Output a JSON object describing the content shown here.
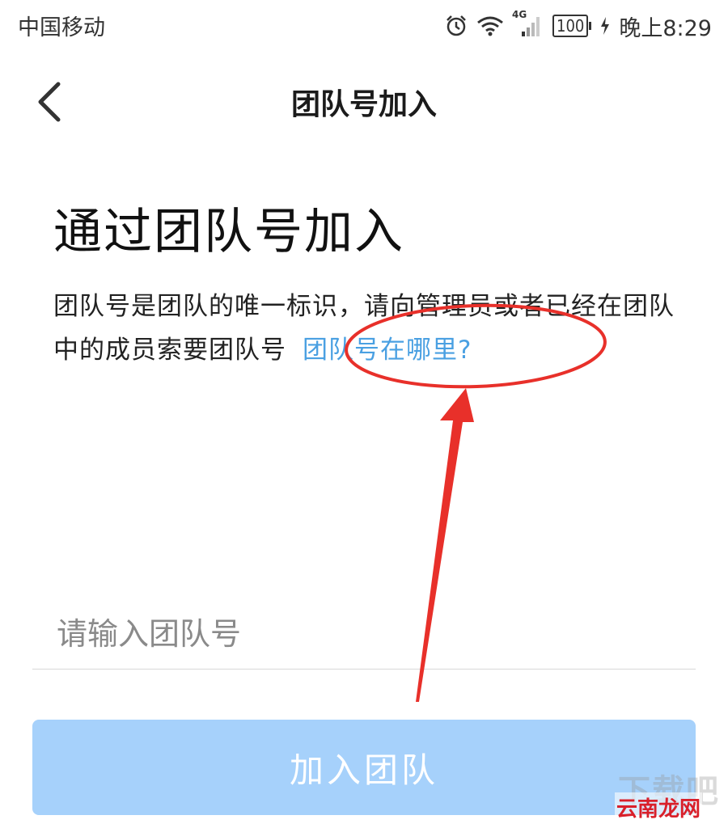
{
  "status_bar": {
    "carrier": "中国移动",
    "network": "4G",
    "battery": "100",
    "time": "晚上8:29",
    "icons": [
      "alarm-icon",
      "wifi-icon",
      "signal-icon",
      "charging-icon"
    ]
  },
  "nav": {
    "title": "团队号加入",
    "back_icon": "chevron-left-icon"
  },
  "main": {
    "heading": "通过团队号加入",
    "description": "团队号是团队的唯一标识，请向管理员或者已经在团队中的成员索要团队号",
    "help_link": "团队号在哪里?",
    "input_placeholder": "请输入团队号",
    "input_value": "",
    "join_button": "加入团队"
  },
  "watermark": {
    "top": "下载吧",
    "bottom": "云南龙网"
  },
  "colors": {
    "link": "#4aa0e2",
    "button_disabled": "#a6d1fb",
    "annotation": "#e8302a"
  }
}
